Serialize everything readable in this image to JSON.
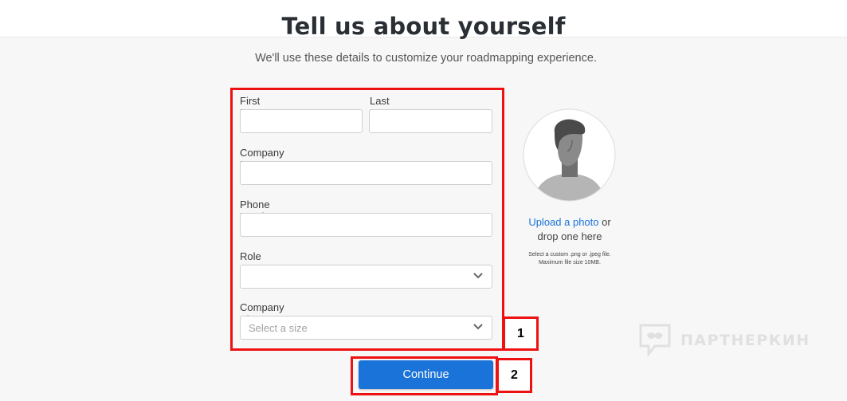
{
  "header": {
    "title": "Tell us about yourself",
    "subtitle": "We'll use these details to customize your roadmapping experience."
  },
  "form": {
    "first_name_label": "First Name",
    "last_name_label": "Last Name",
    "company_name_label": "Company Name",
    "phone_number_label": "Phone Number",
    "role_label": "Role",
    "role_value": "",
    "company_size_label": "Company Size",
    "company_size_placeholder": "Select a size",
    "continue_label": "Continue"
  },
  "photo": {
    "upload_link": "Upload a photo",
    "upload_suffix": " or",
    "drop_text": "drop one here",
    "note": "Select a custom .png or .jpeg file. Maximum file size 10MB."
  },
  "annotations": {
    "box1_number": "1",
    "box2_number": "2",
    "highlight_color": "#ee1111"
  },
  "watermark": {
    "text": "ПАРТНЕРКИН"
  },
  "colors": {
    "accent": "#1a73d9",
    "background": "#f7f7f7"
  }
}
